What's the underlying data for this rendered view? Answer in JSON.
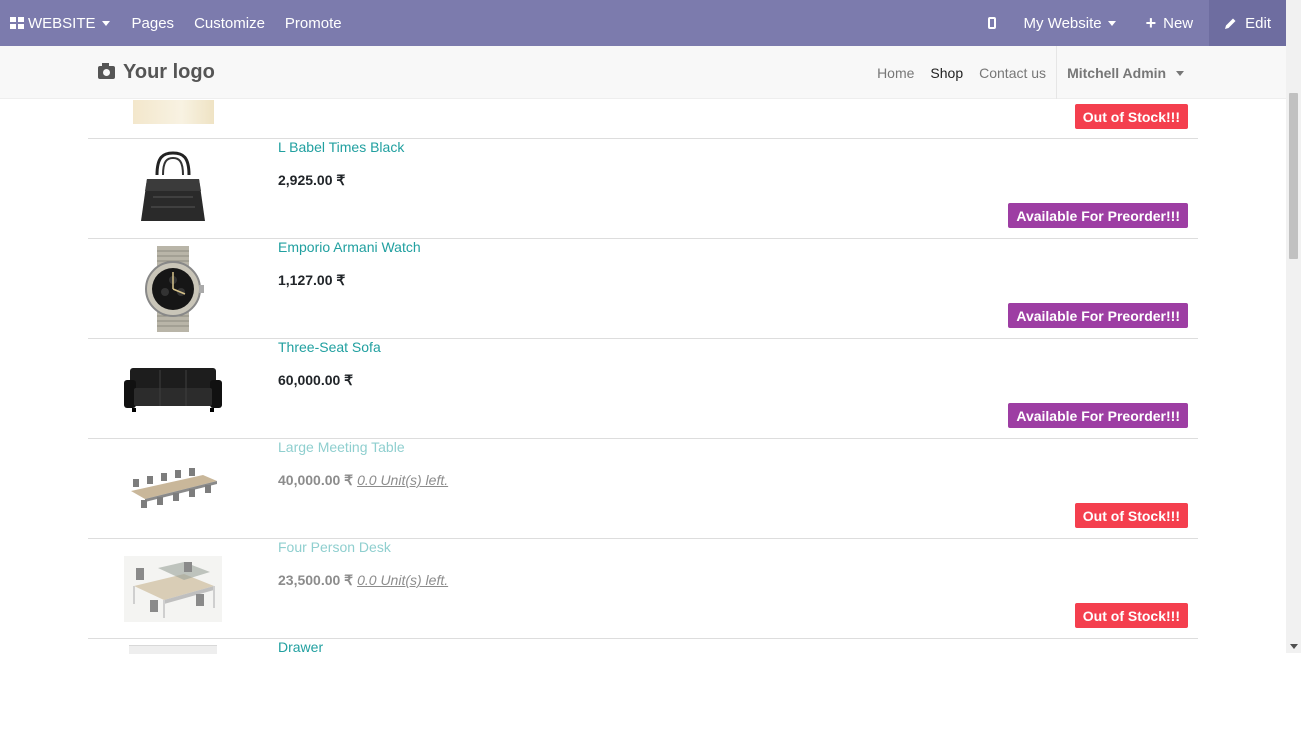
{
  "admin_bar": {
    "brand": "WEBSITE",
    "menu": [
      "Pages",
      "Customize",
      "Promote"
    ],
    "website_selector": "My Website",
    "new_label": "New",
    "edit_label": "Edit"
  },
  "header": {
    "logo_text": "Your logo",
    "nav": [
      "Home",
      "Shop",
      "Contact us"
    ],
    "active_nav": "Shop",
    "user": "Mitchell Admin"
  },
  "products": [
    {
      "name": "",
      "price": "",
      "units_left": "",
      "badge": "Out of Stock!!!",
      "badge_type": "out",
      "image": "partial-product-image"
    },
    {
      "name": "L Babel Times Black",
      "price": "2,925.00 ₹",
      "units_left": "",
      "badge": "Available For Preorder!!!",
      "badge_type": "pre",
      "image": "handbag"
    },
    {
      "name": "Emporio Armani Watch",
      "price": "1,127.00 ₹",
      "units_left": "",
      "badge": "Available For Preorder!!!",
      "badge_type": "pre",
      "image": "watch"
    },
    {
      "name": "Three-Seat Sofa",
      "price": "60,000.00 ₹",
      "units_left": "",
      "badge": "Available For Preorder!!!",
      "badge_type": "pre",
      "image": "sofa"
    },
    {
      "name": "Large Meeting Table",
      "price": "40,000.00 ₹",
      "units_left": "0.0 Unit(s) left.",
      "badge": "Out of Stock!!!",
      "badge_type": "out",
      "image": "meeting-table"
    },
    {
      "name": "Four Person Desk",
      "price": "23,500.00 ₹",
      "units_left": "0.0 Unit(s) left.",
      "badge": "Out of Stock!!!",
      "badge_type": "out",
      "image": "desk"
    },
    {
      "name": "Drawer",
      "price": "",
      "units_left": "",
      "badge": "",
      "badge_type": "",
      "image": "drawer"
    }
  ],
  "colors": {
    "admin_bar": "#7c7bad",
    "link": "#21a0a0",
    "out_of_stock": "#f43f4e",
    "preorder": "#9d3ea3"
  }
}
